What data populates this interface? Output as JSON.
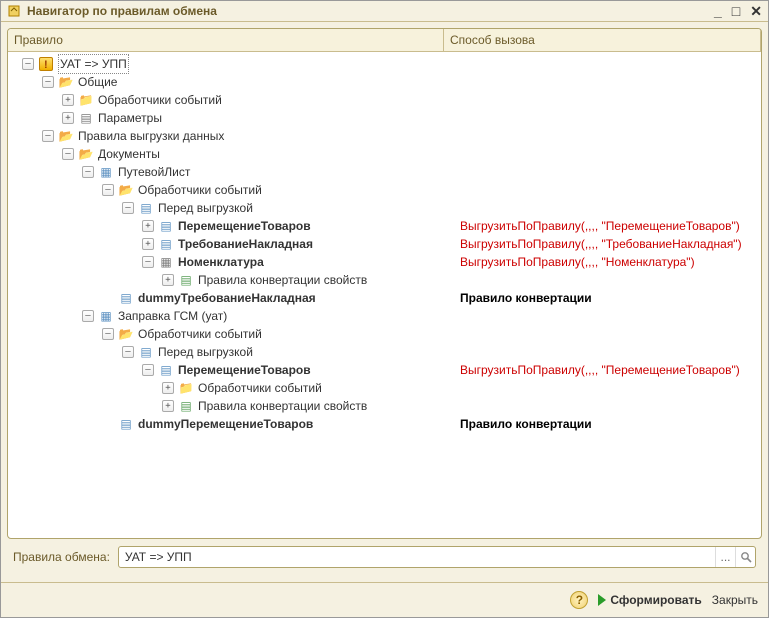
{
  "window": {
    "title": "Навигатор по правилам обмена"
  },
  "columns": {
    "rule": "Правило",
    "call": "Способ вызова"
  },
  "tree": {
    "root": {
      "label": "УАТ => УПП",
      "children": {
        "common": {
          "label": "Общие",
          "handlers": "Обработчики событий",
          "params": "Параметры"
        },
        "export_rules": {
          "label": "Правила выгрузки данных",
          "documents": {
            "label": "Документы",
            "putevoy": {
              "label": "ПутевойЛист",
              "handlers": "Обработчики событий",
              "before_export": {
                "label": "Перед выгрузкой",
                "move_goods": {
                  "label": "ПеремещениеТоваров",
                  "call": "ВыгрузитьПоПравилу(,,,, \"ПеремещениеТоваров\")"
                },
                "treb_nakl": {
                  "label": "ТребованиеНакладная",
                  "call": "ВыгрузитьПоПравилу(,,,, \"ТребованиеНакладная\")"
                },
                "nomenkl": {
                  "label": "Номенклатура",
                  "call": "ВыгрузитьПоПравилу(,,,, \"Номенклатура\")",
                  "props": "Правила конвертации свойств"
                }
              },
              "dummy_treb": {
                "label": "dummyТребованиеНакладная",
                "call": "Правило конвертации"
              }
            },
            "zapravka": {
              "label": "Заправка ГСМ (уат)",
              "handlers": "Обработчики событий",
              "before_export": {
                "label": "Перед выгрузкой",
                "move_goods": {
                  "label": "ПеремещениеТоваров",
                  "call": "ВыгрузитьПоПравилу(,,,, \"ПеремещениеТоваров\")",
                  "handlers": "Обработчики событий",
                  "props": "Правила конвертации свойств"
                }
              },
              "dummy_move": {
                "label": "dummyПеремещениеТоваров",
                "call": "Правило конвертации"
              }
            }
          }
        }
      }
    }
  },
  "footer": {
    "label": "Правила обмена:",
    "value": "УАТ => УПП",
    "ellipsis": "...",
    "search": "🔍"
  },
  "buttons": {
    "generate": "Сформировать",
    "close": "Закрыть",
    "help": "?"
  }
}
